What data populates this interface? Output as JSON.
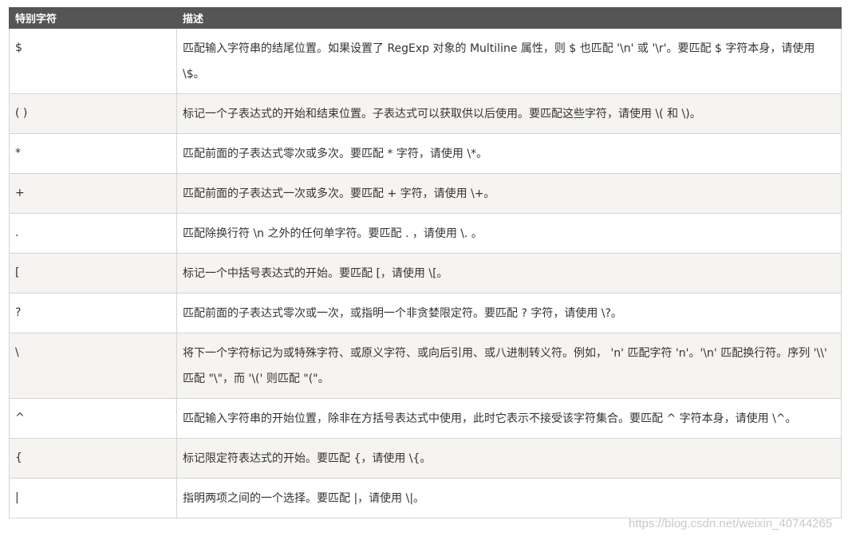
{
  "table": {
    "headers": [
      "特别字符",
      "描述"
    ],
    "rows": [
      {
        "char": "$",
        "desc": "匹配输入字符串的结尾位置。如果设置了 RegExp 对象的 Multiline 属性，则 $ 也匹配 '\\n' 或 '\\r'。要匹配 $ 字符本身，请使用 \\$。"
      },
      {
        "char": "( )",
        "desc": "标记一个子表达式的开始和结束位置。子表达式可以获取供以后使用。要匹配这些字符，请使用 \\( 和 \\)。"
      },
      {
        "char": "*",
        "desc": "匹配前面的子表达式零次或多次。要匹配 * 字符，请使用 \\*。"
      },
      {
        "char": "+",
        "desc": "匹配前面的子表达式一次或多次。要匹配 + 字符，请使用 \\+。"
      },
      {
        "char": ".",
        "desc": "匹配除换行符 \\n 之外的任何单字符。要匹配 . ，请使用 \\. 。"
      },
      {
        "char": "[",
        "desc": "标记一个中括号表达式的开始。要匹配 [，请使用 \\[。"
      },
      {
        "char": "?",
        "desc": "匹配前面的子表达式零次或一次，或指明一个非贪婪限定符。要匹配 ? 字符，请使用 \\?。"
      },
      {
        "char": "\\",
        "desc": "将下一个字符标记为或特殊字符、或原义字符、或向后引用、或八进制转义符。例如， 'n' 匹配字符 'n'。'\\n' 匹配换行符。序列 '\\\\' 匹配 \"\\\"，而 '\\(' 则匹配 \"(\"。"
      },
      {
        "char": "^",
        "desc": "匹配输入字符串的开始位置，除非在方括号表达式中使用，此时它表示不接受该字符集合。要匹配 ^ 字符本身，请使用 \\^。"
      },
      {
        "char": "{",
        "desc": "标记限定符表达式的开始。要匹配 {，请使用 \\{。"
      },
      {
        "char": "|",
        "desc": "指明两项之间的一个选择。要匹配 |，请使用 \\|。"
      }
    ]
  },
  "watermark": "https://blog.csdn.net/weixin_40744265"
}
